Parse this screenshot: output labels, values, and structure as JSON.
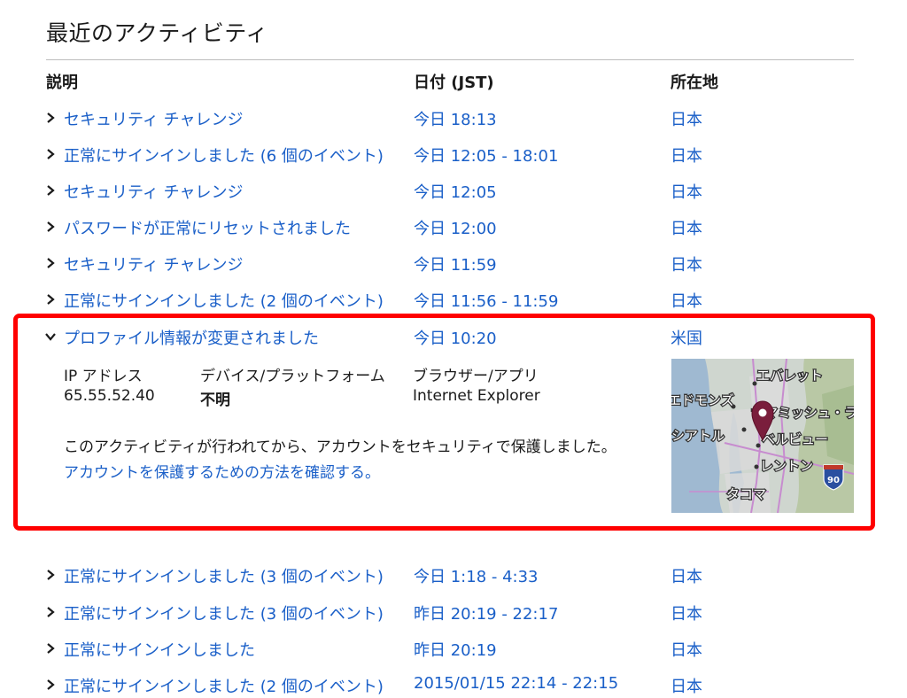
{
  "page": {
    "title": "最近のアクティビティ"
  },
  "columns": {
    "description": "説明",
    "date": "日付 (JST)",
    "location": "所在地"
  },
  "rows": [
    {
      "description": "セキュリティ チャレンジ",
      "date": "今日 18:13",
      "location": "日本",
      "expanded": false
    },
    {
      "description": "正常にサインインしました (6 個のイベント)",
      "date": "今日 12:05 - 18:01",
      "location": "日本",
      "expanded": false
    },
    {
      "description": "セキュリティ チャレンジ",
      "date": "今日 12:05",
      "location": "日本",
      "expanded": false
    },
    {
      "description": "パスワードが正常にリセットされました",
      "date": "今日 12:00",
      "location": "日本",
      "expanded": false
    },
    {
      "description": "セキュリティ チャレンジ",
      "date": "今日 11:59",
      "location": "日本",
      "expanded": false
    },
    {
      "description": "正常にサインインしました (2 個のイベント)",
      "date": "今日 11:56 - 11:59",
      "location": "日本",
      "expanded": false
    },
    {
      "description": "プロファイル情報が変更されました",
      "date": "今日 10:20",
      "location": "米国",
      "expanded": true
    },
    {
      "description": "正常にサインインしました (3 個のイベント)",
      "date": "今日 1:18 - 4:33",
      "location": "日本",
      "expanded": false
    },
    {
      "description": "正常にサインインしました (3 個のイベント)",
      "date": "昨日 20:19 - 22:17",
      "location": "日本",
      "expanded": false
    },
    {
      "description": "正常にサインインしました",
      "date": "昨日 20:19",
      "location": "日本",
      "expanded": false
    },
    {
      "description": "正常にサインインしました (2 個のイベント)",
      "date": "2015/01/15 22:14 - 22:15",
      "location": "日本",
      "expanded": false
    }
  ],
  "details": {
    "ip_label": "IP アドレス",
    "ip_value": "65.55.52.40",
    "device_label": "デバイス/プラットフォーム",
    "device_value": "不明",
    "browser_label": "ブラウザー/アプリ",
    "browser_value": "Internet Explorer",
    "note": "このアクティビティが行われてから、アカウントをセキュリティで保護しました。",
    "link": "アカウントを保護するための方法を確認する。",
    "map": {
      "labels": [
        "エバレット",
        "エドモンズ",
        "シアトル",
        "ベルビュー",
        "レントン",
        "タコマ",
        "サマミッシュ・ライン"
      ],
      "highway_shield": "90"
    }
  },
  "colors": {
    "link": "#1a5fc8",
    "highlight": "#ff0000",
    "pin": "#7a1e3c"
  }
}
